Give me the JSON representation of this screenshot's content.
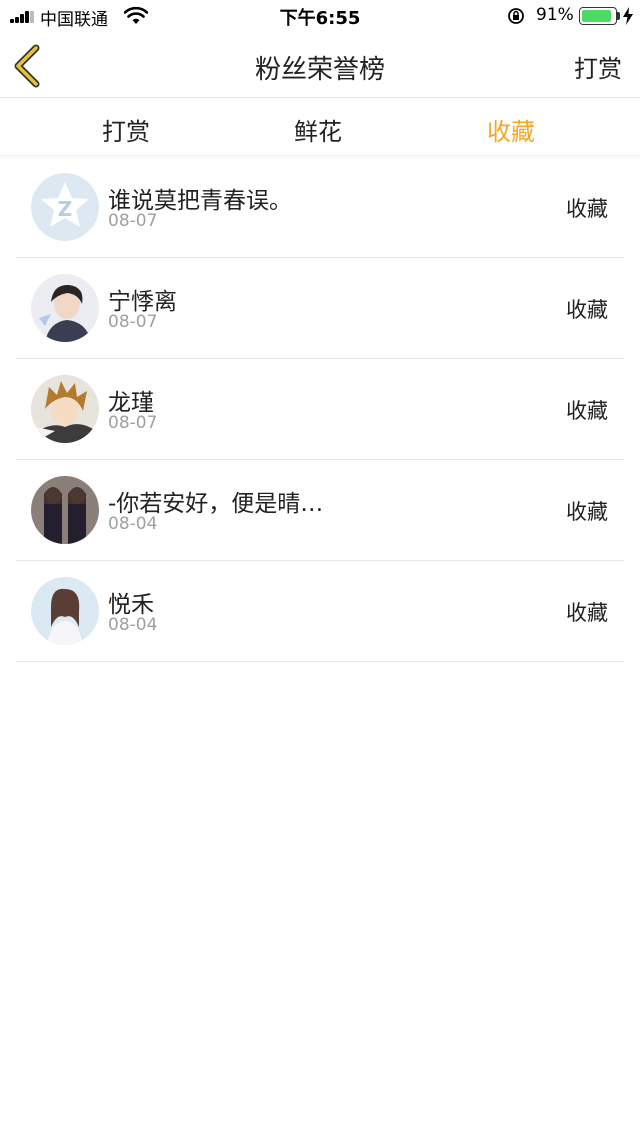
{
  "status_bar": {
    "carrier": "中国联通",
    "time": "下午6:55",
    "battery": "91%",
    "battery_level": 0.91
  },
  "nav": {
    "title": "粉丝荣誉榜",
    "action": "打赏",
    "back_icon": "chevron-left-icon"
  },
  "tabs": [
    {
      "label": "打赏",
      "active": false
    },
    {
      "label": "鲜花",
      "active": false
    },
    {
      "label": "收藏",
      "active": true
    }
  ],
  "colors": {
    "accent": "#f0a826",
    "back_arrow": "#e8c23a"
  },
  "rows": [
    {
      "name": "谁说莫把青春误。",
      "date": "08-07",
      "action": "收藏",
      "avatar": "default-qq-avatar"
    },
    {
      "name": "宁悸离",
      "date": "08-07",
      "action": "收藏",
      "avatar": "user-photo-avatar"
    },
    {
      "name": "龙瑾",
      "date": "08-07",
      "action": "收藏",
      "avatar": "anime-avatar"
    },
    {
      "name": "-你若安好，便是晴…",
      "date": "08-04",
      "action": "收藏",
      "avatar": "user-photo-avatar"
    },
    {
      "name": "悦禾",
      "date": "08-04",
      "action": "收藏",
      "avatar": "user-photo-avatar"
    }
  ]
}
